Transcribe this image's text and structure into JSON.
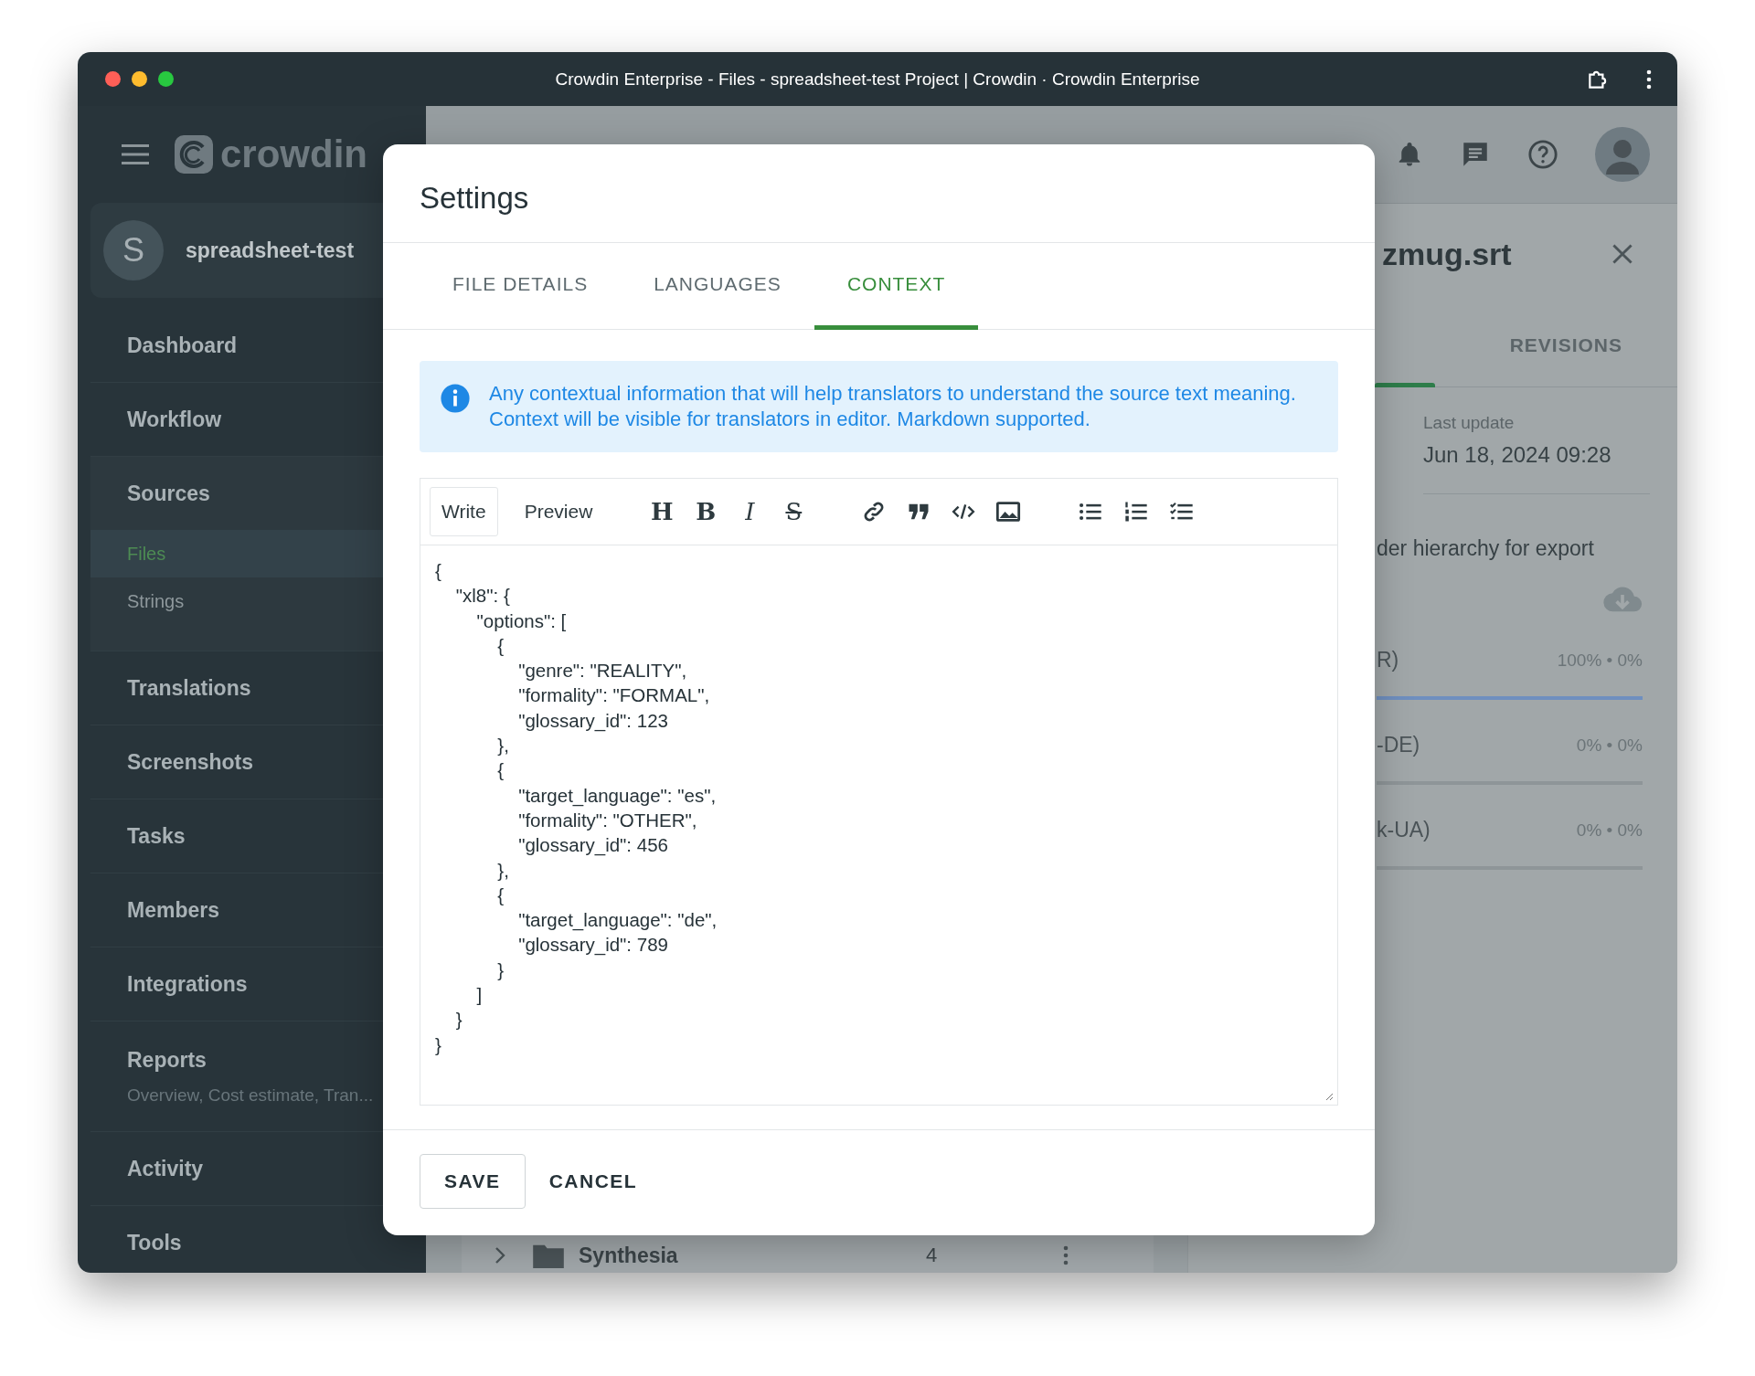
{
  "window": {
    "title": "Crowdin Enterprise - Files - spreadsheet-test Project | Crowdin · Crowdin Enterprise"
  },
  "sidebar": {
    "logo": "crowdin",
    "project": {
      "initial": "S",
      "name": "spreadsheet-test"
    },
    "items": [
      {
        "label": "Dashboard",
        "kind": "item"
      },
      {
        "label": "Workflow",
        "kind": "item"
      },
      {
        "label": "Sources",
        "kind": "group",
        "expanded": true,
        "children": [
          {
            "label": "Files",
            "selected": true
          },
          {
            "label": "Strings",
            "selected": false
          }
        ]
      },
      {
        "label": "Translations",
        "kind": "item"
      },
      {
        "label": "Screenshots",
        "kind": "item"
      },
      {
        "label": "Tasks",
        "kind": "item"
      },
      {
        "label": "Members",
        "kind": "item"
      },
      {
        "label": "Integrations",
        "kind": "item"
      },
      {
        "label": "Reports",
        "kind": "item",
        "subtitle": "Overview, Cost estimate, Tran..."
      },
      {
        "label": "Activity",
        "kind": "item"
      },
      {
        "label": "Tools",
        "kind": "item"
      }
    ]
  },
  "file_list": {
    "rows": [
      {
        "name": "Synthesia",
        "count": "4"
      }
    ]
  },
  "file_panel": {
    "title": "zmug.srt",
    "tabs": [
      {
        "label": "REVISIONS",
        "selected": false
      }
    ],
    "last_update_label": "Last update",
    "last_update": "Jun 18, 2024 09:28",
    "option": "der hierarchy for export",
    "languages": [
      {
        "name": "R)",
        "reading": "100% • 0%",
        "level": 1
      },
      {
        "name": "-DE)",
        "reading": "0% • 0%",
        "level": 0
      },
      {
        "name": "k-UA)",
        "reading": "0% • 0%",
        "level": 0
      }
    ]
  },
  "dialog": {
    "title": "Settings",
    "tabs": [
      {
        "label": "FILE DETAILS",
        "selected": false
      },
      {
        "label": "LANGUAGES",
        "selected": false
      },
      {
        "label": "CONTEXT",
        "selected": true
      }
    ],
    "info": "Any contextual information that will help translators to understand the source text meaning. Context will be visible for translators in editor. Markdown supported.",
    "editor": {
      "modes": [
        {
          "label": "Write",
          "selected": true
        },
        {
          "label": "Preview",
          "selected": false
        }
      ],
      "format_glyphs": [
        "H",
        "B",
        "I",
        "S"
      ],
      "value": "{\n    \"xl8\": {\n        \"options\": [\n            {\n                \"genre\": \"REALITY\",\n                \"formality\": \"FORMAL\",\n                \"glossary_id\": 123\n            },\n            {\n                \"target_language\": \"es\",\n                \"formality\": \"OTHER\",\n                \"glossary_id\": 456\n            },\n            {\n                \"target_language\": \"de\",\n                \"glossary_id\": 789\n            }\n        ]\n    }\n}"
    },
    "buttons": [
      {
        "label": "SAVE",
        "kind": "outlined"
      },
      {
        "label": "CANCEL",
        "kind": "text"
      }
    ]
  }
}
